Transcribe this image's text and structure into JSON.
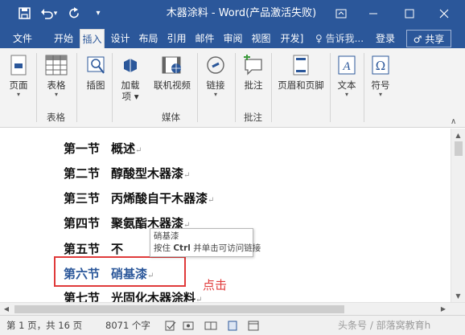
{
  "titlebar": {
    "title": "木器涂料 - Word(产品激活失败)",
    "qat": {
      "save": "save-icon",
      "undo": "undo-icon",
      "undo_arrow": "▾",
      "redo": "redo-icon",
      "customize": "▾"
    },
    "window": {
      "restore": "restore-icon",
      "minimize": "minimize-icon",
      "maximize": "maximize-icon",
      "close": "close-icon"
    }
  },
  "tabs": [
    {
      "label": "文件"
    },
    {
      "label": "开始"
    },
    {
      "label": "插入",
      "active": true
    },
    {
      "label": "设计"
    },
    {
      "label": "布局"
    },
    {
      "label": "引用"
    },
    {
      "label": "邮件"
    },
    {
      "label": "审阅"
    },
    {
      "label": "视图"
    },
    {
      "label": "开发]"
    }
  ],
  "tellme": "♀ 告诉我...",
  "login": "登录",
  "share": "♂ 共享",
  "ribbon": {
    "buttons": [
      {
        "label": "页面",
        "caret": "▾"
      },
      {
        "label": "表格",
        "caret": "▾"
      },
      {
        "label": "插图",
        "caret": ""
      },
      {
        "label": "加载",
        "label2": "项",
        "caret": "▾"
      },
      {
        "label": "联机视频",
        "caret": ""
      },
      {
        "label": "链接",
        "caret": "▾"
      },
      {
        "label": "批注",
        "caret": ""
      },
      {
        "label": "页眉和页脚",
        "caret": ""
      },
      {
        "label": "文本",
        "caret": "▾"
      },
      {
        "label": "符号",
        "caret": "▾"
      }
    ],
    "groups": {
      "table": "表格",
      "media": "媒体",
      "comment": "批注"
    },
    "collapse": "∧"
  },
  "document": {
    "lines": [
      {
        "num": "第一节",
        "title": "概述",
        "mark": "↵"
      },
      {
        "num": "第二节",
        "title": "醇酸型木器漆",
        "mark": "↵"
      },
      {
        "num": "第三节",
        "title": "丙烯酸自干木器漆",
        "mark": "↵"
      },
      {
        "num": "第四节",
        "title": "聚氨酯木器漆",
        "mark": "↵"
      },
      {
        "num": "第五节",
        "title": "不",
        "mark": ""
      },
      {
        "num": "第六节",
        "title": "硝基漆",
        "mark": "↵"
      },
      {
        "num": "第七节",
        "title": "光固化木器涂料",
        "mark": "↵"
      }
    ],
    "tooltip": {
      "title": "硝基漆",
      "hint_pre": "按住",
      "hint_key": "Ctrl",
      "hint_post": "并单击可访问链接"
    },
    "annotation": "点击"
  },
  "status": {
    "page": "第 1 页，共 16 页",
    "words": "8071 个字",
    "watermark": "头条号 / 部落窝教育h"
  },
  "colors": {
    "accent": "#2b579a",
    "annotation": "#e03a3a",
    "ribbon_bg": "#f3f3f3"
  }
}
